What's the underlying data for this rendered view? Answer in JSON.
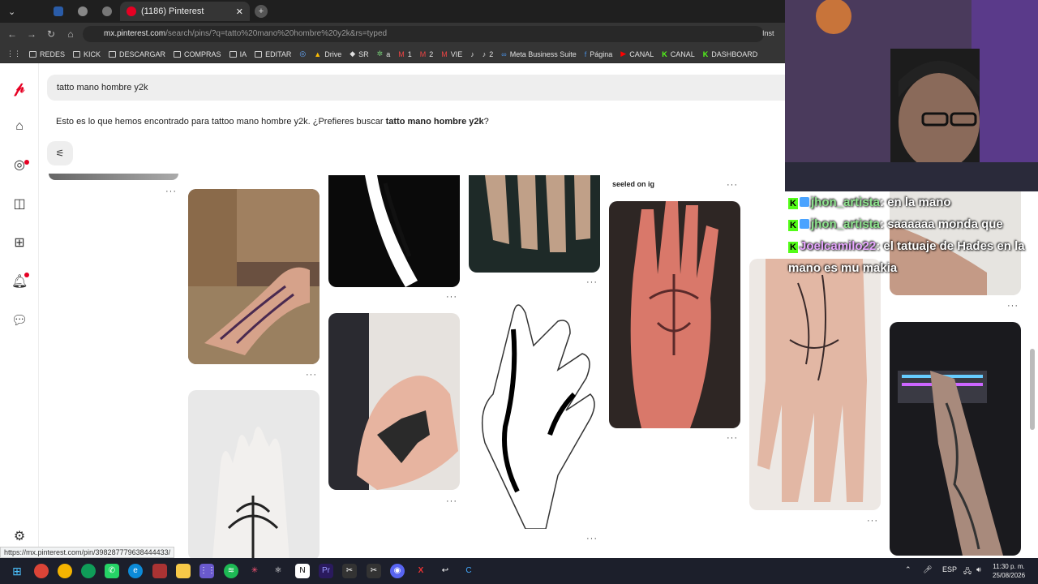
{
  "browser": {
    "tabs": [
      {
        "label": "",
        "kind": "menu"
      },
      {
        "label": "",
        "kind": "icon"
      },
      {
        "label": "",
        "kind": "icon"
      },
      {
        "label": "",
        "kind": "icon"
      },
      {
        "label": "(1186) Pinterest",
        "kind": "page"
      }
    ],
    "url_host": "mx.pinterest.com",
    "url_path": "/search/pins/?q=tatto%20mano%20hombre%20y2k&rs=typed",
    "right_label": "Inst",
    "bookmarks": [
      "REDES",
      "KICK",
      "DESCARGAR",
      "COMPRAS",
      "IA",
      "EDITAR",
      "Drive",
      "SR",
      "a",
      "1",
      "2",
      "VIE",
      "2",
      "Meta Business Suite",
      "Página",
      "CANAL",
      "CANAL",
      "DASHBOARD"
    ]
  },
  "search": {
    "query": "tatto mano hombre y2k",
    "suggest_prefix": "Esto es lo que hemos encontrado para tattoo mano hombre y2k. ¿Prefieres buscar ",
    "suggest_term": "tatto mano hombre y2k",
    "suggest_suffix": "?"
  },
  "pins": {
    "label_seeled": "seeled on ig",
    "more": "···"
  },
  "chat": [
    {
      "user": "jhon_artista",
      "message": ": en la mano"
    },
    {
      "user": "jhon_artista",
      "message": ": saaaaaa monda que"
    },
    {
      "user": "Joelcamilo22",
      "message": ": el tatuaje de Hades en la mano es mu makia"
    }
  ],
  "status_url": "https://mx.pinterest.com/pin/398287779638444433/",
  "taskbar": {
    "lang": "ESP",
    "time": "11:30 p. m.",
    "date": "25/08/2026"
  },
  "colors": {
    "pinterest_red": "#e60023",
    "kick_green": "#53fc18"
  }
}
